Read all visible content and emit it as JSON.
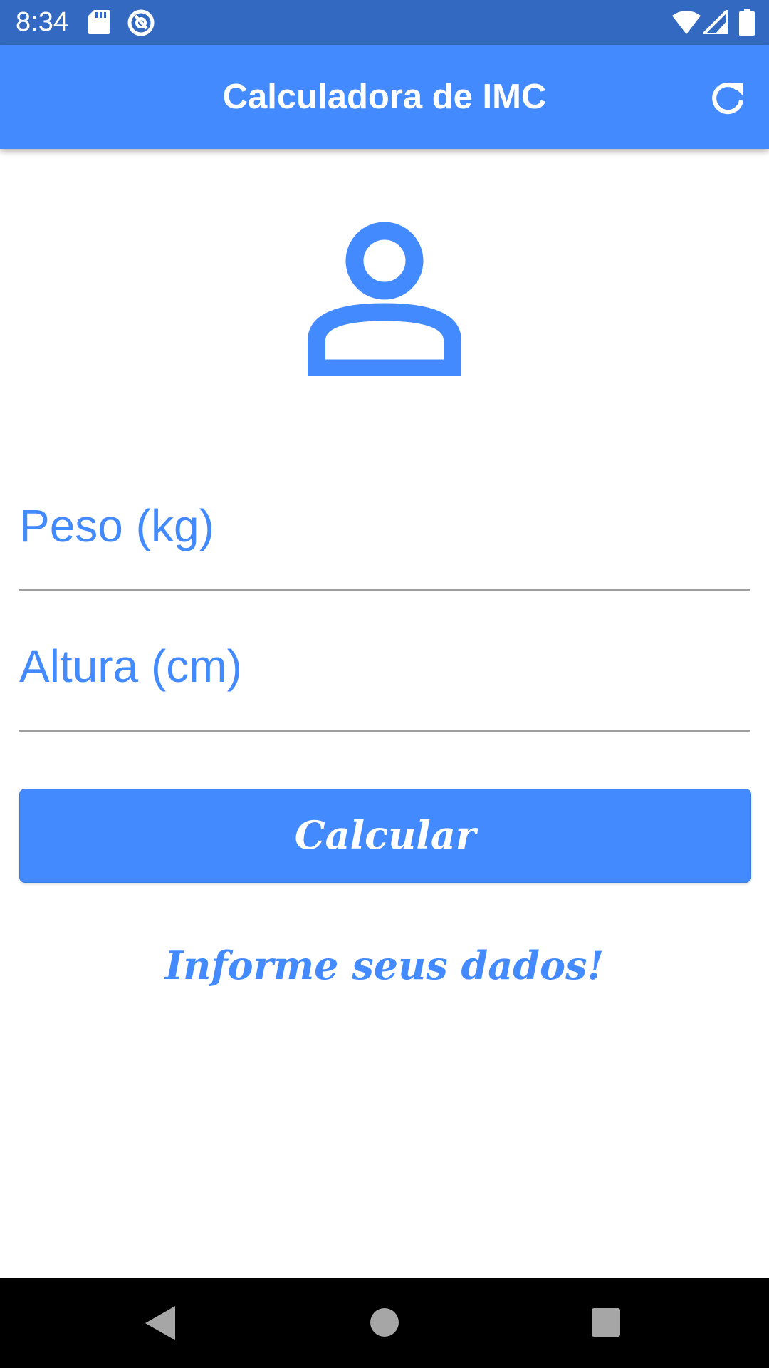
{
  "status_bar": {
    "time": "8:34",
    "icons": [
      "sd-card-icon",
      "at-sign-icon",
      "wifi-icon",
      "cell-signal-icon",
      "battery-icon"
    ]
  },
  "app_bar": {
    "title": "Calculadora de IMC",
    "refresh_icon": "refresh-icon",
    "color": "#448aff"
  },
  "main": {
    "avatar_icon": "person-outline-icon",
    "weight_field": {
      "placeholder": "Peso (kg)",
      "value": ""
    },
    "height_field": {
      "placeholder": "Altura (cm)",
      "value": ""
    },
    "calculate_button": "Calcular",
    "info_text": "Informe seus dados!"
  },
  "nav_bar": {
    "icons": [
      "back-triangle-icon",
      "home-circle-icon",
      "recents-square-icon"
    ]
  },
  "colors": {
    "status_bar": "#3469c2",
    "accent": "#448aff",
    "divider": "#9e9e9e"
  }
}
